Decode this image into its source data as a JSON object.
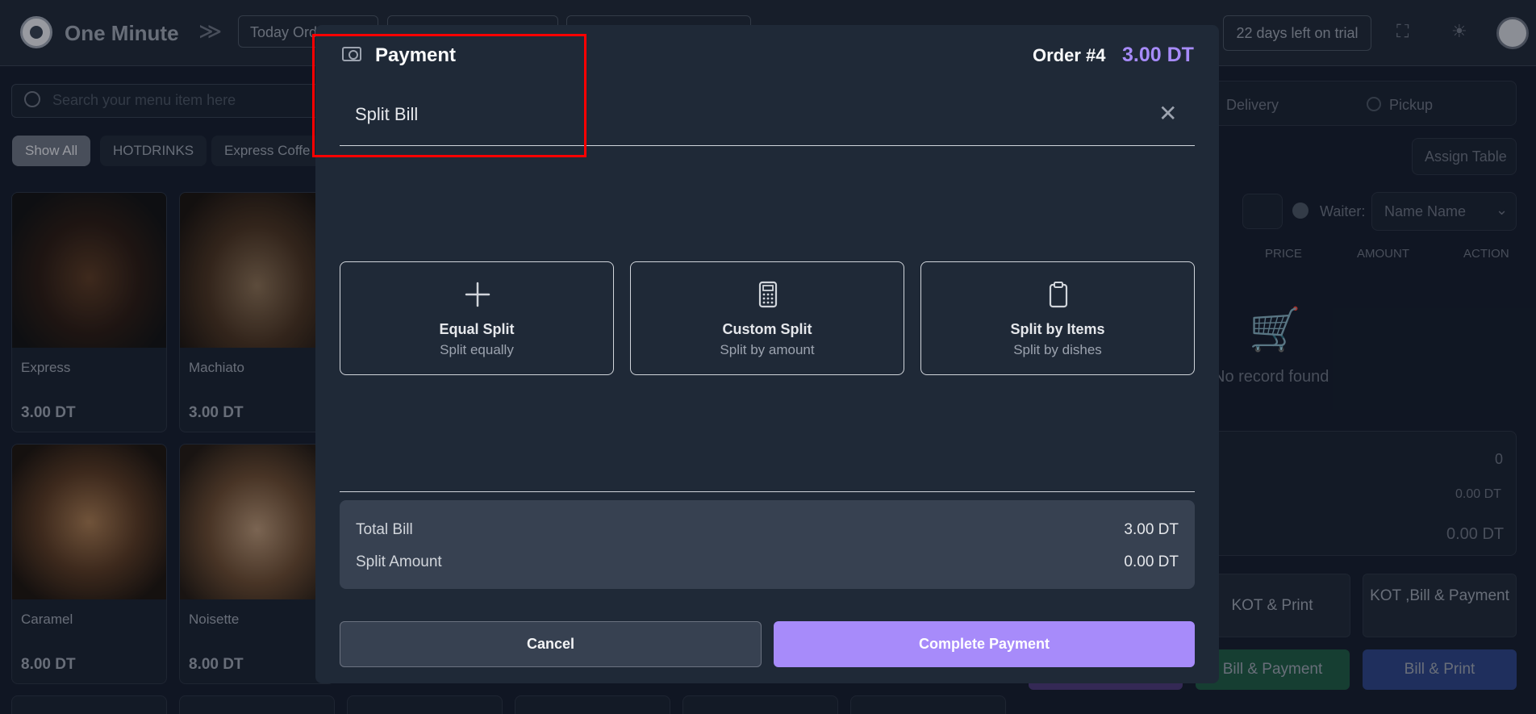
{
  "app": {
    "title": "One Minute",
    "trial": "22 days left on trial",
    "top_pill_1": "Today Ord"
  },
  "search": {
    "placeholder": "Search your menu item here"
  },
  "categories": [
    "Show All",
    "HOTDRINKS",
    "Express Coffe"
  ],
  "menu_items": [
    {
      "name": "Express",
      "price": "3.00 DT"
    },
    {
      "name": "Machiato",
      "price": "3.00 DT"
    },
    {
      "name": "Caramel",
      "price": "8.00 DT"
    },
    {
      "name": "Noisette",
      "price": "8.00 DT"
    }
  ],
  "order_panel": {
    "order_types": [
      "Delivery",
      "Pickup"
    ],
    "assign_table": "Assign Table",
    "waiter_label": "Waiter:",
    "waiter_value": "Name Name",
    "columns": [
      "PRICE",
      "AMOUNT",
      "ACTION"
    ],
    "empty": "No record found",
    "totals": [
      "0",
      "0.00 DT",
      "0.00 DT"
    ],
    "buttons": [
      "KOT & Print",
      "KOT ,Bill & Payment",
      "Bill & Payment",
      "Bill & Print"
    ]
  },
  "modal": {
    "title": "Payment",
    "order_label": "Order #4",
    "order_amount": "3.00 DT",
    "split_title": "Split Bill",
    "options": [
      {
        "title": "Equal Split",
        "subtitle": "Split equally",
        "icon": "plus-icon"
      },
      {
        "title": "Custom Split",
        "subtitle": "Split by amount",
        "icon": "calculator-icon"
      },
      {
        "title": "Split by Items",
        "subtitle": "Split by dishes",
        "icon": "clipboard-icon"
      }
    ],
    "summary": {
      "total_label": "Total Bill",
      "total_value": "3.00 DT",
      "split_label": "Split Amount",
      "split_value": "0.00 DT"
    },
    "cancel": "Cancel",
    "complete": "Complete Payment"
  },
  "colors": {
    "accent": "#a78bfa",
    "modal_bg": "#1f2937",
    "highlight": "#ff0000"
  }
}
